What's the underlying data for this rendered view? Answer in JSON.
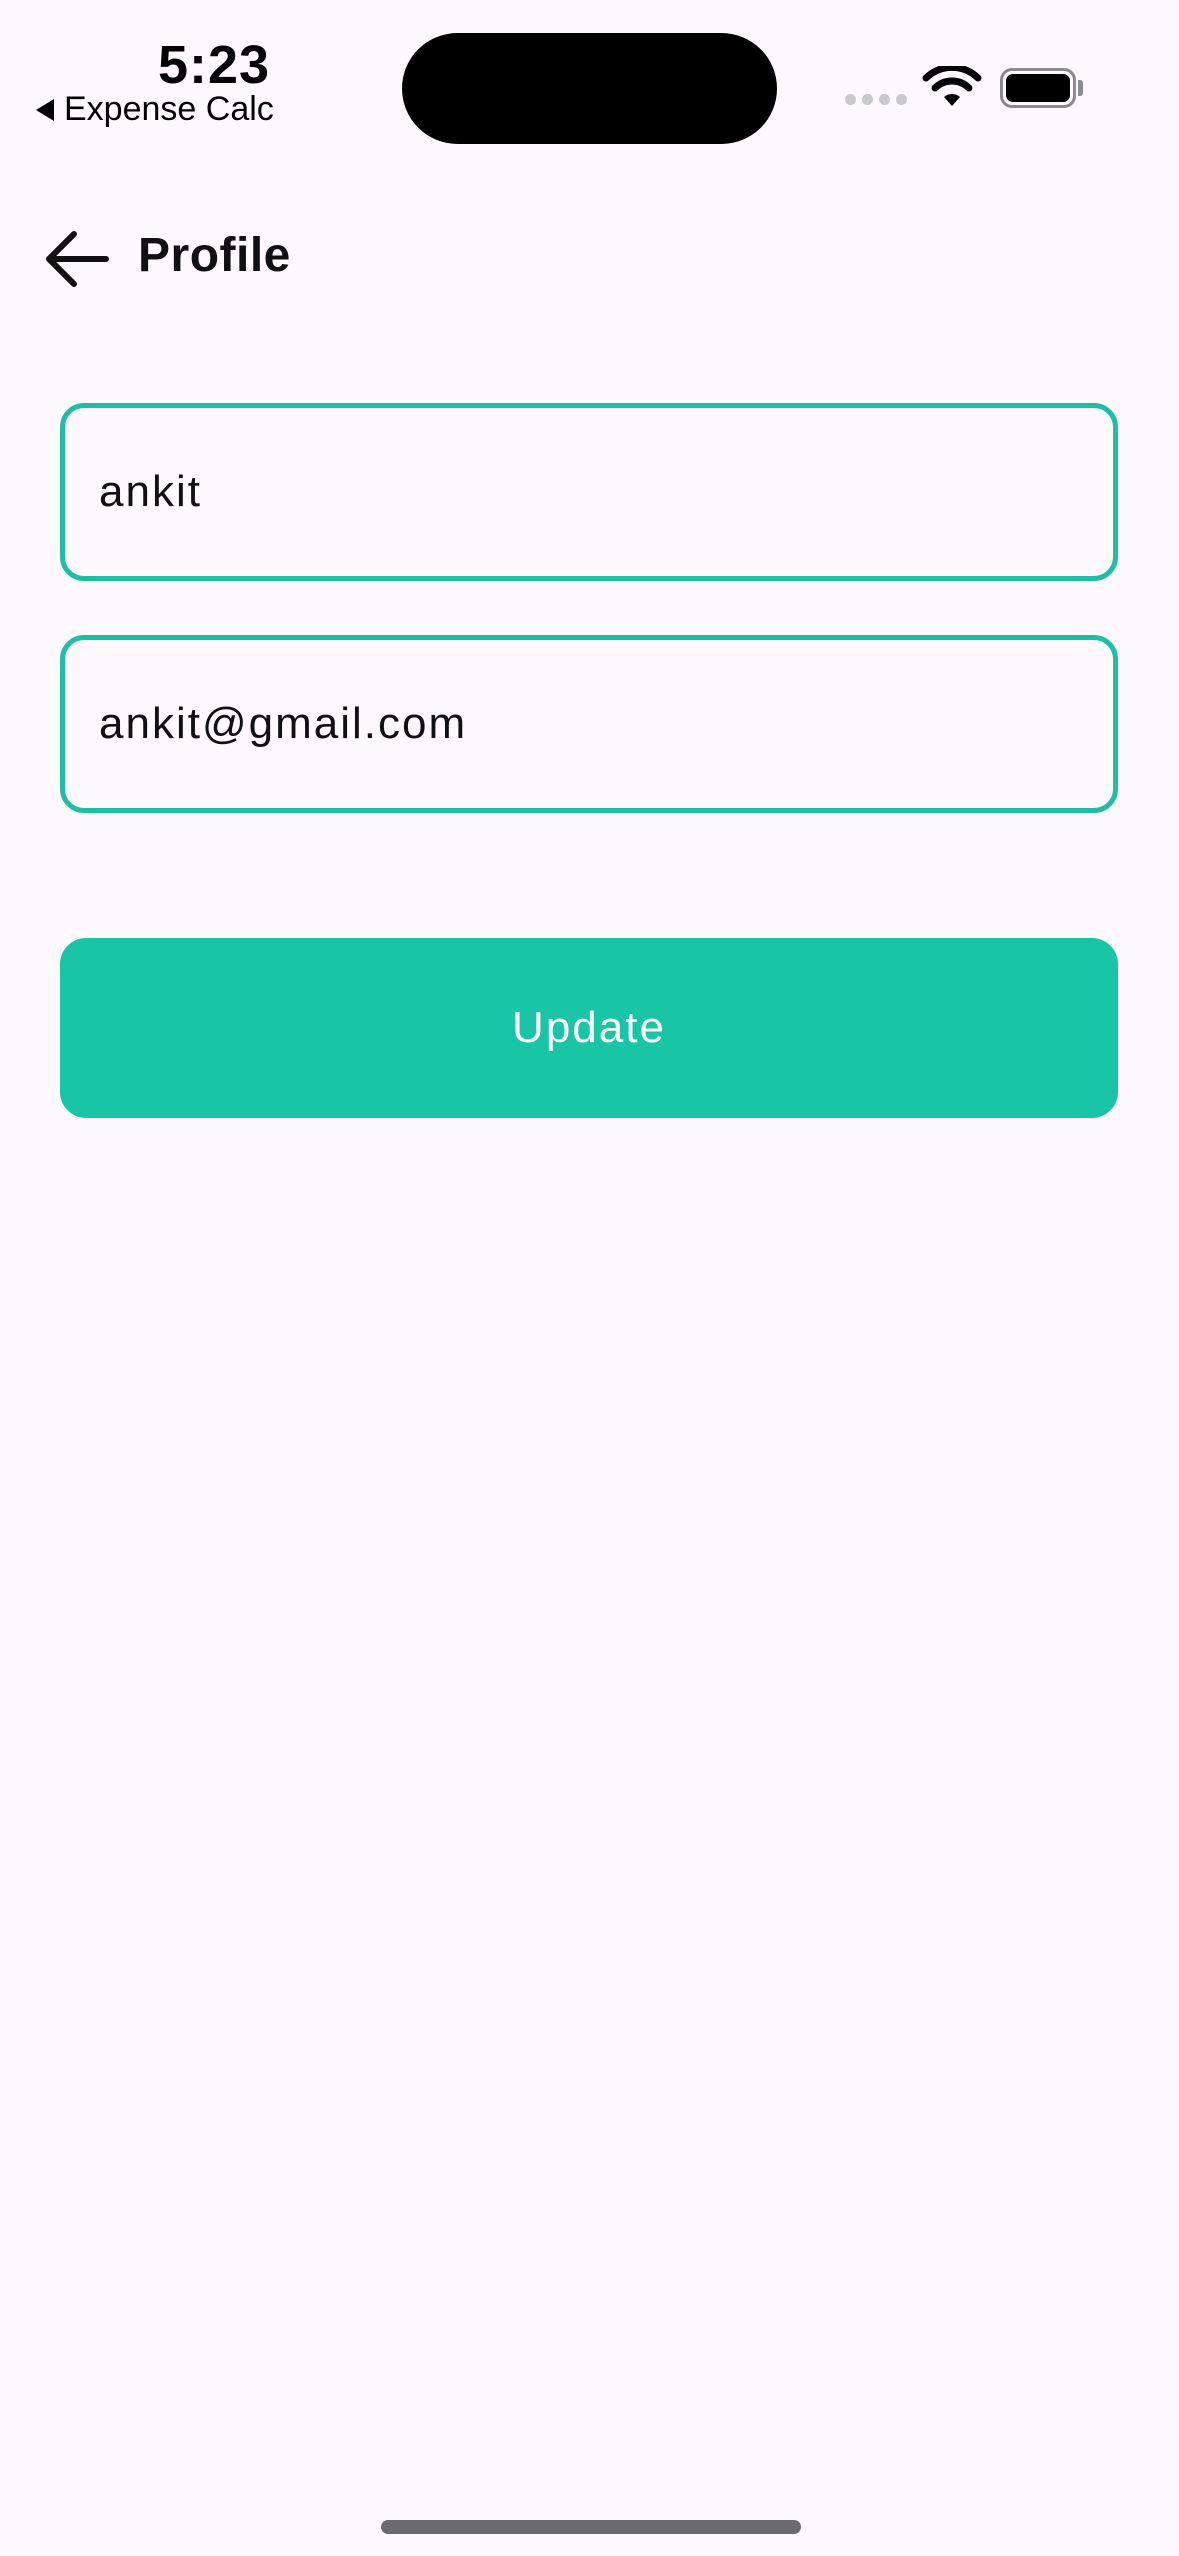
{
  "status_bar": {
    "time": "5:23",
    "back_app_label": "Expense Calc"
  },
  "app_bar": {
    "title": "Profile",
    "back_icon": "arrow-left-icon"
  },
  "form": {
    "name_value": "ankit",
    "email_value": "ankit@gmail.com"
  },
  "actions": {
    "update_label": "Update"
  },
  "colors": {
    "accent": "#18C6A5",
    "field_border": "#1FBFA3",
    "background": "#FDF9FD"
  }
}
